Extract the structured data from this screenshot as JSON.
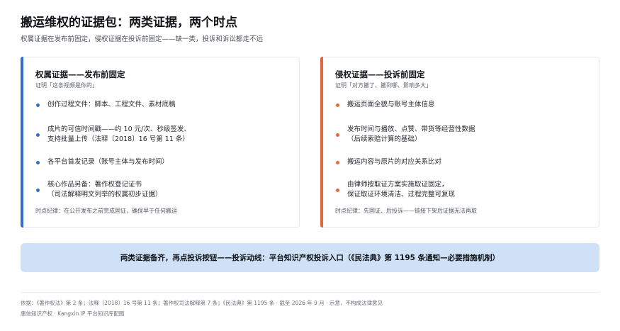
{
  "header": {
    "title": "搬运维权的证据包：两类证据，两个时点",
    "subtitle": "权属证据在发布前固定，侵权证据在投诉前固定——缺一类，投诉和诉讼都走不远"
  },
  "cards": [
    {
      "title": "权属证据——发布前固定",
      "subtitle": "证明「这条视频是你的」",
      "accent": "#2f6fd0",
      "items": [
        "创作过程文件：脚本、工程文件、素材底稿",
        "成片的可信时间戳——约 10 元/次、秒级签发、\n支持批量上传（法释〔2018〕16 号第 11 条）",
        "各平台首发记录（账号主体与发布时间）",
        "核心作品另备：著作权登记证书\n（司法解释明文列举的权属初步证据）"
      ],
      "footer": "时点纪律：在公开发布之前完成固证，确保早于任何搬运"
    },
    {
      "title": "侵权证据——投诉前固定",
      "subtitle": "证明「对方搬了、搬到哪、影响多大」",
      "accent": "#e3683e",
      "items": [
        "搬运页面全貌与账号主体信息",
        "发布时间与播放、点赞、带货等经营性数据\n（后续索赔计算的基础）",
        "搬运内容与原片的对应关系比对",
        "由律师按取证方案实施取证固定，\n保证取证环境清洁、过程完整可复现"
      ],
      "footer": "时点纪律：先固证、后投诉——链接下架后证据无法再取"
    }
  ],
  "banner": {
    "text": "两类证据备齐，再点投诉按钮——投诉动线：平台知识产权投诉入口（《民法典》第 1195 条通知—必要措施机制）",
    "color": "#cfe1f7"
  },
  "footer": {
    "sources": "依据：《著作权法》第 2 条；法释〔2018〕16 号第 11 条；著作权司法解释第 7 条；《民法典》第 1195 条 · 截至 2026 年 9 月 · 示意，不构成法律意见",
    "credit": "康信知识产权 · Kangxin IP 平台知识库配图"
  }
}
